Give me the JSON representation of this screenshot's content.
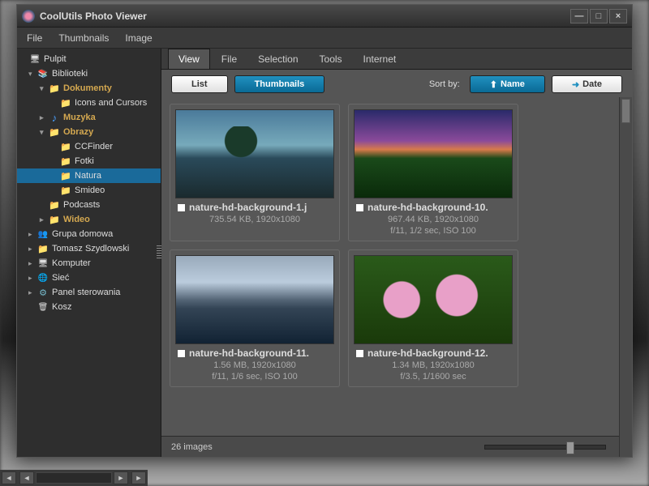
{
  "app": {
    "title": "CoolUtils Photo Viewer"
  },
  "menubar": {
    "file": "File",
    "thumbnails": "Thumbnails",
    "image": "Image"
  },
  "tree": {
    "pulpit": "Pulpit",
    "biblioteki": "Biblioteki",
    "dokumenty": "Dokumenty",
    "icons_cursors": "Icons and Cursors",
    "muzyka": "Muzyka",
    "obrazy": "Obrazy",
    "ccfinder": "CCFinder",
    "fotki": "Fotki",
    "natura": "Natura",
    "smideo": "Smideo",
    "podcasts": "Podcasts",
    "wideo": "Wideo",
    "grupa": "Grupa domowa",
    "tomasz": "Tomasz Szydlowski",
    "komputer": "Komputer",
    "siec": "Sieć",
    "panel": "Panel sterowania",
    "kosz": "Kosz"
  },
  "tabs": {
    "view": "View",
    "file": "File",
    "selection": "Selection",
    "tools": "Tools",
    "internet": "Internet"
  },
  "toolbar": {
    "list": "List",
    "thumbnails": "Thumbnails",
    "sort_by": "Sort by:",
    "name": "Name",
    "date": "Date"
  },
  "thumbs": [
    {
      "name": "nature-hd-background-1.j",
      "line1": "735.54 KB, 1920x1080",
      "line2": ""
    },
    {
      "name": "nature-hd-background-10.",
      "line1": "967.44 KB, 1920x1080",
      "line2": "f/11, 1/2 sec, ISO 100"
    },
    {
      "name": "nature-hd-background-11.",
      "line1": "1.56 MB, 1920x1080",
      "line2": "f/11, 1/6 sec, ISO 100"
    },
    {
      "name": "nature-hd-background-12.",
      "line1": "1.34 MB, 1920x1080",
      "line2": "f/3.5, 1/1600 sec"
    }
  ],
  "status": {
    "count": "26 images"
  }
}
